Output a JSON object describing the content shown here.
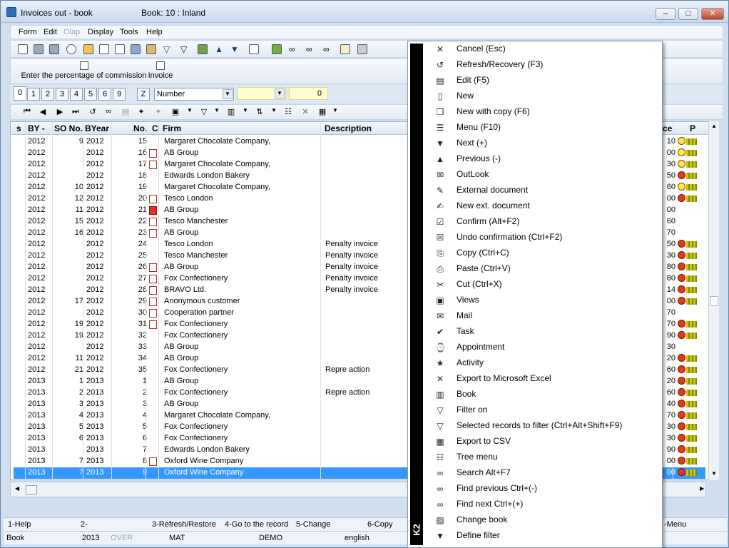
{
  "window": {
    "title": "Invoices out - book",
    "book": "Book: 10 : Inland",
    "buttons": {
      "minimize": "–",
      "maximize": "□",
      "close": "✕"
    }
  },
  "menubar": [
    "Form",
    "Edit",
    "Olap",
    "Display",
    "Tools",
    "Help"
  ],
  "toolbar2": {
    "commission": "Enter the percentage of commission",
    "invoice": "Invoice"
  },
  "filterbar": {
    "tabs": [
      "0",
      "1",
      "2",
      "3",
      "4",
      "5",
      "6",
      "9"
    ],
    "z": "Z",
    "sort": "Number",
    "value": "",
    "number": "0"
  },
  "grid": {
    "headers": {
      "s": "s",
      "by": "BY -",
      "so": "SO No.",
      "byear": "BYear",
      "no": "No.",
      "c": "C",
      "firm": "Firm",
      "desc": "Description",
      "ce": "ce",
      "p": "P"
    },
    "rows": [
      {
        "by": "2012",
        "so": "9",
        "byear": "2012",
        "no": "15",
        "firm": "Margaret Chocolate Company,",
        "desc": "",
        "ce": "10"
      },
      {
        "by": "2012",
        "so": "",
        "byear": "2012",
        "no": "16",
        "firm": "AB Group",
        "desc": "",
        "ce": "00"
      },
      {
        "by": "2012",
        "so": "",
        "byear": "2012",
        "no": "17",
        "firm": "Margaret Chocolate Company,",
        "desc": "",
        "ce": "30"
      },
      {
        "by": "2012",
        "so": "",
        "byear": "2012",
        "no": "18",
        "firm": "Edwards London Bakery",
        "desc": "",
        "ce": "50"
      },
      {
        "by": "2012",
        "so": "10",
        "byear": "2012",
        "no": "19",
        "firm": "Margaret Chocolate Company,",
        "desc": "",
        "ce": "60"
      },
      {
        "by": "2012",
        "so": "12",
        "byear": "2012",
        "no": "20",
        "firm": "Tesco London",
        "desc": "",
        "ce": "00"
      },
      {
        "by": "2012",
        "so": "11",
        "byear": "2012",
        "no": "21",
        "firm": "AB Group",
        "desc": "",
        "ce": "00"
      },
      {
        "by": "2012",
        "so": "15",
        "byear": "2012",
        "no": "22",
        "firm": "Tesco Manchester",
        "desc": "",
        "ce": "60"
      },
      {
        "by": "2012",
        "so": "16",
        "byear": "2012",
        "no": "23",
        "firm": "AB Group",
        "desc": "",
        "ce": "70"
      },
      {
        "by": "2012",
        "so": "",
        "byear": "2012",
        "no": "24",
        "firm": "Tesco London",
        "desc": "Penalty invoice",
        "ce": "50"
      },
      {
        "by": "2012",
        "so": "",
        "byear": "2012",
        "no": "25",
        "firm": "Tesco Manchester",
        "desc": "Penalty invoice",
        "ce": "30"
      },
      {
        "by": "2012",
        "so": "",
        "byear": "2012",
        "no": "26",
        "firm": "AB Group",
        "desc": "Penalty invoice",
        "ce": "80"
      },
      {
        "by": "2012",
        "so": "",
        "byear": "2012",
        "no": "27",
        "firm": "Fox Confectionery",
        "desc": "Penalty invoice",
        "ce": "80"
      },
      {
        "by": "2012",
        "so": "",
        "byear": "2012",
        "no": "28",
        "firm": "BRAVO Ltd.",
        "desc": "Penalty invoice",
        "ce": "14"
      },
      {
        "by": "2012",
        "so": "17",
        "byear": "2012",
        "no": "29",
        "firm": "Anonymous customer",
        "desc": "",
        "ce": "00"
      },
      {
        "by": "2012",
        "so": "",
        "byear": "2012",
        "no": "30",
        "firm": "Cooperation partner",
        "desc": "",
        "ce": "70"
      },
      {
        "by": "2012",
        "so": "19",
        "byear": "2012",
        "no": "31",
        "firm": "Fox Confectionery",
        "desc": "",
        "ce": "70"
      },
      {
        "by": "2012",
        "so": "19",
        "byear": "2012",
        "no": "32",
        "firm": "Fox Confectionery",
        "desc": "",
        "ce": "90"
      },
      {
        "by": "2012",
        "so": "",
        "byear": "2012",
        "no": "33",
        "firm": "AB Group",
        "desc": "",
        "ce": "30"
      },
      {
        "by": "2012",
        "so": "11",
        "byear": "2012",
        "no": "34",
        "firm": "AB Group",
        "desc": "",
        "ce": "20"
      },
      {
        "by": "2012",
        "so": "21",
        "byear": "2012",
        "no": "35",
        "firm": "Fox Confectionery",
        "desc": "Repre action",
        "ce": "60"
      },
      {
        "by": "2013",
        "so": "1",
        "byear": "2013",
        "no": "1",
        "firm": "AB Group",
        "desc": "",
        "ce": "20"
      },
      {
        "by": "2013",
        "so": "2",
        "byear": "2013",
        "no": "2",
        "firm": "Fox Confectionery",
        "desc": "Repre action",
        "ce": "60"
      },
      {
        "by": "2013",
        "so": "3",
        "byear": "2013",
        "no": "3",
        "firm": "AB Group",
        "desc": "",
        "ce": "40"
      },
      {
        "by": "2013",
        "so": "4",
        "byear": "2013",
        "no": "4",
        "firm": "Margaret Chocolate Company,",
        "desc": "",
        "ce": "70"
      },
      {
        "by": "2013",
        "so": "5",
        "byear": "2013",
        "no": "5",
        "firm": "Fox Confectionery",
        "desc": "",
        "ce": "30"
      },
      {
        "by": "2013",
        "so": "6",
        "byear": "2013",
        "no": "6",
        "firm": "Fox Confectionery",
        "desc": "",
        "ce": "30"
      },
      {
        "by": "2013",
        "so": "",
        "byear": "2013",
        "no": "7",
        "firm": "Edwards London Bakery",
        "desc": "",
        "ce": "90"
      },
      {
        "by": "2013",
        "so": "7",
        "byear": "2013",
        "no": "8",
        "firm": "Oxford Wine Company",
        "desc": "",
        "ce": "00"
      },
      {
        "by": "2013",
        "so": "7",
        "byear": "2013",
        "no": "9",
        "firm": "Oxford Wine Company",
        "desc": "",
        "ce": "00"
      }
    ]
  },
  "fkeys": [
    "1-Help",
    "2-",
    "3-Refresh/Restore",
    "4-Go to the record",
    "5-Change",
    "6-Copy",
    "-Menu"
  ],
  "status": [
    "Book",
    "2013",
    "OVER",
    "MAT",
    "DEMO",
    "english"
  ],
  "ctx": {
    "logo": "K2",
    "items": [
      {
        "label": "Cancel (Esc)",
        "icon": "cancel-icon",
        "glyph": "✕"
      },
      {
        "label": "Refresh/Recovery (F3)",
        "icon": "refresh-icon",
        "glyph": "↺"
      },
      {
        "label": "Edit (F5)",
        "icon": "folder-open-icon",
        "glyph": "▤"
      },
      {
        "label": "New",
        "icon": "new-document-icon",
        "glyph": "▯"
      },
      {
        "label": "New with copy (F6)",
        "icon": "copy-document-icon",
        "glyph": "❐"
      },
      {
        "label": "Menu (F10)",
        "icon": "menu-icon",
        "glyph": "☰"
      },
      {
        "label": "Next (+)",
        "icon": "arrow-down-icon",
        "glyph": "▼"
      },
      {
        "label": "Previous (-)",
        "icon": "arrow-up-icon",
        "glyph": "▲"
      },
      {
        "label": "OutLook",
        "icon": "outlook-icon",
        "glyph": "✉"
      },
      {
        "label": "External document",
        "icon": "external-document-icon",
        "glyph": "✎"
      },
      {
        "label": "New ext. document",
        "icon": "new-external-document-icon",
        "glyph": "✍"
      },
      {
        "label": "Confirm (Alt+F2)",
        "icon": "confirm-icon",
        "glyph": "☑"
      },
      {
        "label": "Undo confirmation (Ctrl+F2)",
        "icon": "undo-confirm-icon",
        "glyph": "☒"
      },
      {
        "label": "Copy (Ctrl+C)",
        "icon": "copy-icon",
        "glyph": "⎘"
      },
      {
        "label": "Paste (Ctrl+V)",
        "icon": "paste-icon",
        "glyph": "⎙"
      },
      {
        "label": "Cut (Ctrl+X)",
        "icon": "scissors-icon",
        "glyph": "✂"
      },
      {
        "label": "Views",
        "icon": "views-icon",
        "glyph": "▣"
      },
      {
        "label": "Mail",
        "icon": "mail-icon",
        "glyph": "✉"
      },
      {
        "label": "Task",
        "icon": "task-icon",
        "glyph": "✔"
      },
      {
        "label": "Appointment",
        "icon": "appointment-icon",
        "glyph": "⌚"
      },
      {
        "label": "Activity",
        "icon": "activity-icon",
        "glyph": "★"
      },
      {
        "label": "Export to Microsoft Excel",
        "icon": "excel-icon",
        "glyph": "✕"
      },
      {
        "label": "Book",
        "icon": "book-icon",
        "glyph": "▥"
      },
      {
        "label": "Filter on",
        "icon": "filter-icon",
        "glyph": "▽"
      },
      {
        "label": "Selected records to filter (Ctrl+Alt+Shift+F9)",
        "icon": "filter-selected-icon",
        "glyph": "▽"
      },
      {
        "label": "Export to CSV",
        "icon": "csv-icon",
        "glyph": "▦"
      },
      {
        "label": "Tree menu",
        "icon": "tree-icon",
        "glyph": "☷"
      },
      {
        "label": "Search Alt+F7",
        "icon": "binoculars-icon",
        "glyph": "∞"
      },
      {
        "label": "Find previous Ctrl+(-)",
        "icon": "find-previous-icon",
        "glyph": "∞"
      },
      {
        "label": "Find next Ctrl+(+)",
        "icon": "find-next-icon",
        "glyph": "∞"
      },
      {
        "label": "Change book",
        "icon": "change-book-icon",
        "glyph": "▨"
      },
      {
        "label": "Define filter",
        "icon": "define-filter-icon",
        "glyph": "▼"
      }
    ]
  }
}
